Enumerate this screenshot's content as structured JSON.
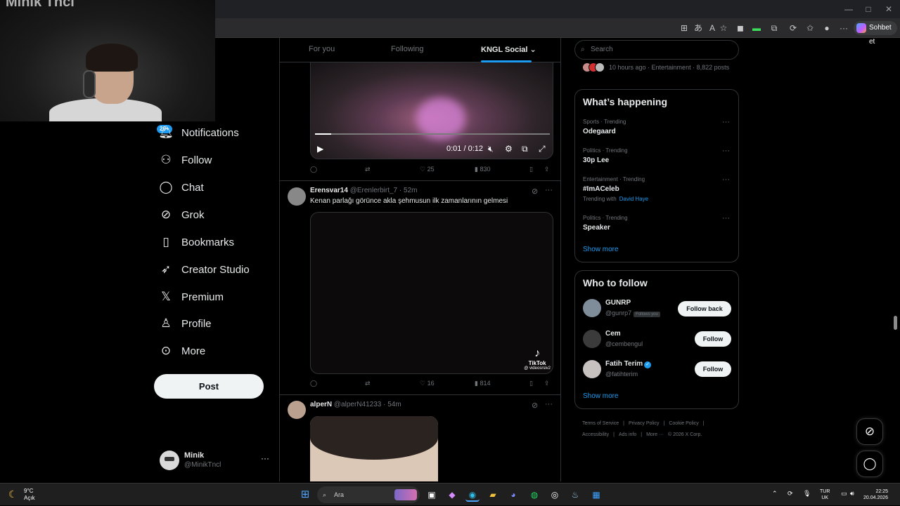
{
  "webcam": {
    "watermark": "Minik Tncl"
  },
  "browser": {
    "chat_button": "Sohbet et",
    "window_controls": [
      "—",
      "□",
      "✕"
    ]
  },
  "nav": {
    "notifications_badge": "20+",
    "items": [
      {
        "label": "Notifications",
        "icon": "bell-icon"
      },
      {
        "label": "Follow",
        "icon": "person-plus-icon"
      },
      {
        "label": "Chat",
        "icon": "chat-bubble-icon"
      },
      {
        "label": "Grok",
        "icon": "grok-icon"
      },
      {
        "label": "Bookmarks",
        "icon": "bookmark-icon"
      },
      {
        "label": "Creator Studio",
        "icon": "rocket-icon"
      },
      {
        "label": "Premium",
        "icon": "x-logo-icon"
      },
      {
        "label": "Profile",
        "icon": "person-icon"
      },
      {
        "label": "More",
        "icon": "more-circle-icon"
      }
    ],
    "post_button": "Post",
    "account": {
      "name": "Minik",
      "handle": "@MinikTncl"
    }
  },
  "timeline": {
    "tabs": [
      "For you",
      "Following",
      "KNGL Social"
    ],
    "active_tab": "KNGL Social",
    "tweet1": {
      "video_time": "0:01 / 0:12",
      "progress": 0.07,
      "likes": "25",
      "views": "830"
    },
    "tweet2": {
      "name": "Erensvar14",
      "handle": "@Erenlerbirt_7",
      "time": "52m",
      "text": "Kenan parlağı görünce akla şehmusun ilk zamanlarının gelmesi",
      "watermark": "TikTok",
      "watermark_user": "@ videosrsiv2",
      "likes": "16",
      "views": "814"
    },
    "tweet3": {
      "name": "alperN",
      "handle": "@alperN41233",
      "time": "54m"
    }
  },
  "right": {
    "search_placeholder": "Search",
    "previous_trend_meta": "10 hours ago · Entertainment · 8,822 posts",
    "whats_happening": {
      "title": "What’s happening",
      "trends": [
        {
          "category": "Sports · Trending",
          "topic": "Odegaard"
        },
        {
          "category": "Politics · Trending",
          "topic": "30p Lee"
        },
        {
          "category": "Entertainment · Trending",
          "topic": "#ImACeleb",
          "with_label": "Trending with",
          "with": "David Haye"
        },
        {
          "category": "Politics · Trending",
          "topic": "Speaker"
        }
      ],
      "show_more": "Show more"
    },
    "who_to_follow": {
      "title": "Who to follow",
      "accounts": [
        {
          "name": "GUNRP",
          "handle": "@gunrp7",
          "follows_you": "Follows you",
          "button": "Follow back"
        },
        {
          "name": "Cem",
          "handle": "@cembengul",
          "button": "Follow"
        },
        {
          "name": "Fatih Terim",
          "handle": "@fatihterim",
          "verified": true,
          "button": "Follow"
        }
      ],
      "show_more": "Show more"
    },
    "footer": [
      "Terms of Service",
      "|",
      "Privacy Policy",
      "|",
      "Cookie Policy",
      "|",
      "Accessibility",
      "|",
      "Ads info",
      "|",
      "More ···",
      "© 2026 X Corp."
    ]
  },
  "taskbar": {
    "weather_temp": "9°C",
    "weather_desc": "Açık",
    "search_placeholder": "Ara",
    "lang_top": "TUR",
    "lang_bottom": "UK",
    "time": "22:25",
    "date": "20.04.2026"
  },
  "colors": {
    "accent": "#1d9bf0",
    "background": "#000000",
    "border": "#2f3336",
    "muted": "#71767b"
  }
}
